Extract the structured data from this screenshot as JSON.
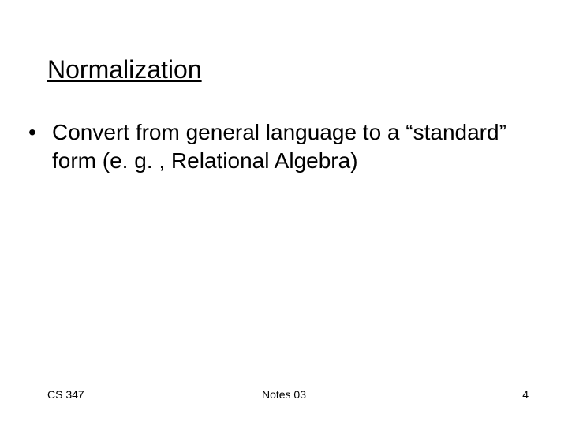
{
  "title": "Normalization",
  "bullets": [
    {
      "text": "Convert from general language to a “standard” form (e. g. ,  Relational Algebra)"
    }
  ],
  "footer": {
    "left": "CS 347",
    "center": "Notes 03",
    "right": "4"
  }
}
